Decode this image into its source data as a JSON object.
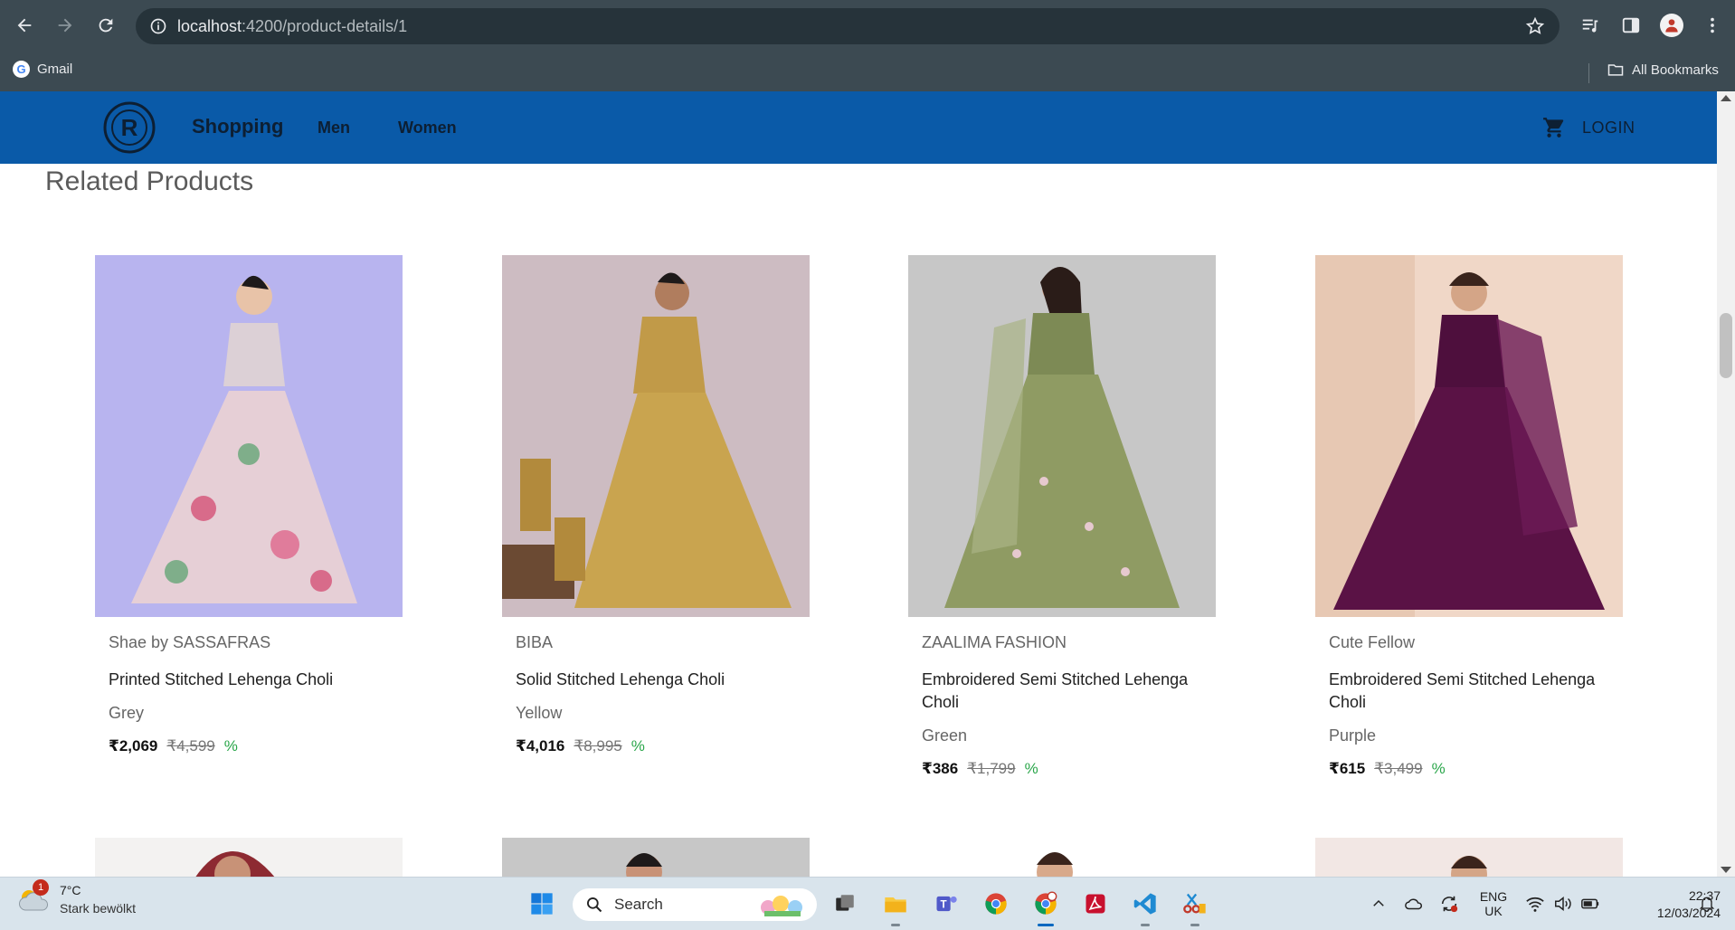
{
  "browser": {
    "url_host": "localhost",
    "url_path": ":4200/product-details/1",
    "bookmarks": [
      {
        "label": "Gmail"
      }
    ],
    "all_bookmarks_label": "All Bookmarks"
  },
  "header": {
    "logo_letter": "R",
    "brand": "Shopping",
    "nav": [
      {
        "label": "Men"
      },
      {
        "label": "Women"
      }
    ],
    "login_label": "LOGIN"
  },
  "main": {
    "section_title": "Related Products",
    "products": [
      {
        "brand": "Shae by SASSAFRAS",
        "title": "Printed Stitched Lehenga Choli",
        "color": "Grey",
        "price": "₹2,069",
        "mrp": "₹4,599",
        "discount": "%",
        "bg": "#b8b4ef",
        "dress": "#e6cfd6"
      },
      {
        "brand": "BIBA",
        "title": "Solid Stitched Lehenga Choli",
        "color": "Yellow",
        "price": "₹4,016",
        "mrp": "₹8,995",
        "discount": "%",
        "bg": "#cdbcc2",
        "dress": "#c9a44f"
      },
      {
        "brand": "ZAALIMA FASHION",
        "title": "Embroidered Semi Stitched Lehenga Choli",
        "color": "Green",
        "price": "₹386",
        "mrp": "₹1,799",
        "discount": "%",
        "bg": "#c7c7c7",
        "dress": "#8f9b63"
      },
      {
        "brand": "Cute Fellow",
        "title": "Embroidered Semi Stitched Lehenga Choli",
        "color": "Purple",
        "price": "₹615",
        "mrp": "₹3,499",
        "discount": "%",
        "bg": "#f0d7c7",
        "dress": "#5a1245"
      }
    ]
  },
  "taskbar": {
    "weather_badge": "1",
    "weather_temp": "7°C",
    "weather_desc": "Stark bewölkt",
    "search_label": "Search",
    "lang_top": "ENG",
    "lang_bottom": "UK",
    "time": "22:37",
    "date": "12/03/2024"
  },
  "colors": {
    "header_bg": "#0a5aa8",
    "chrome_bg": "#3c4a52",
    "discount_green": "#2aa64a"
  }
}
